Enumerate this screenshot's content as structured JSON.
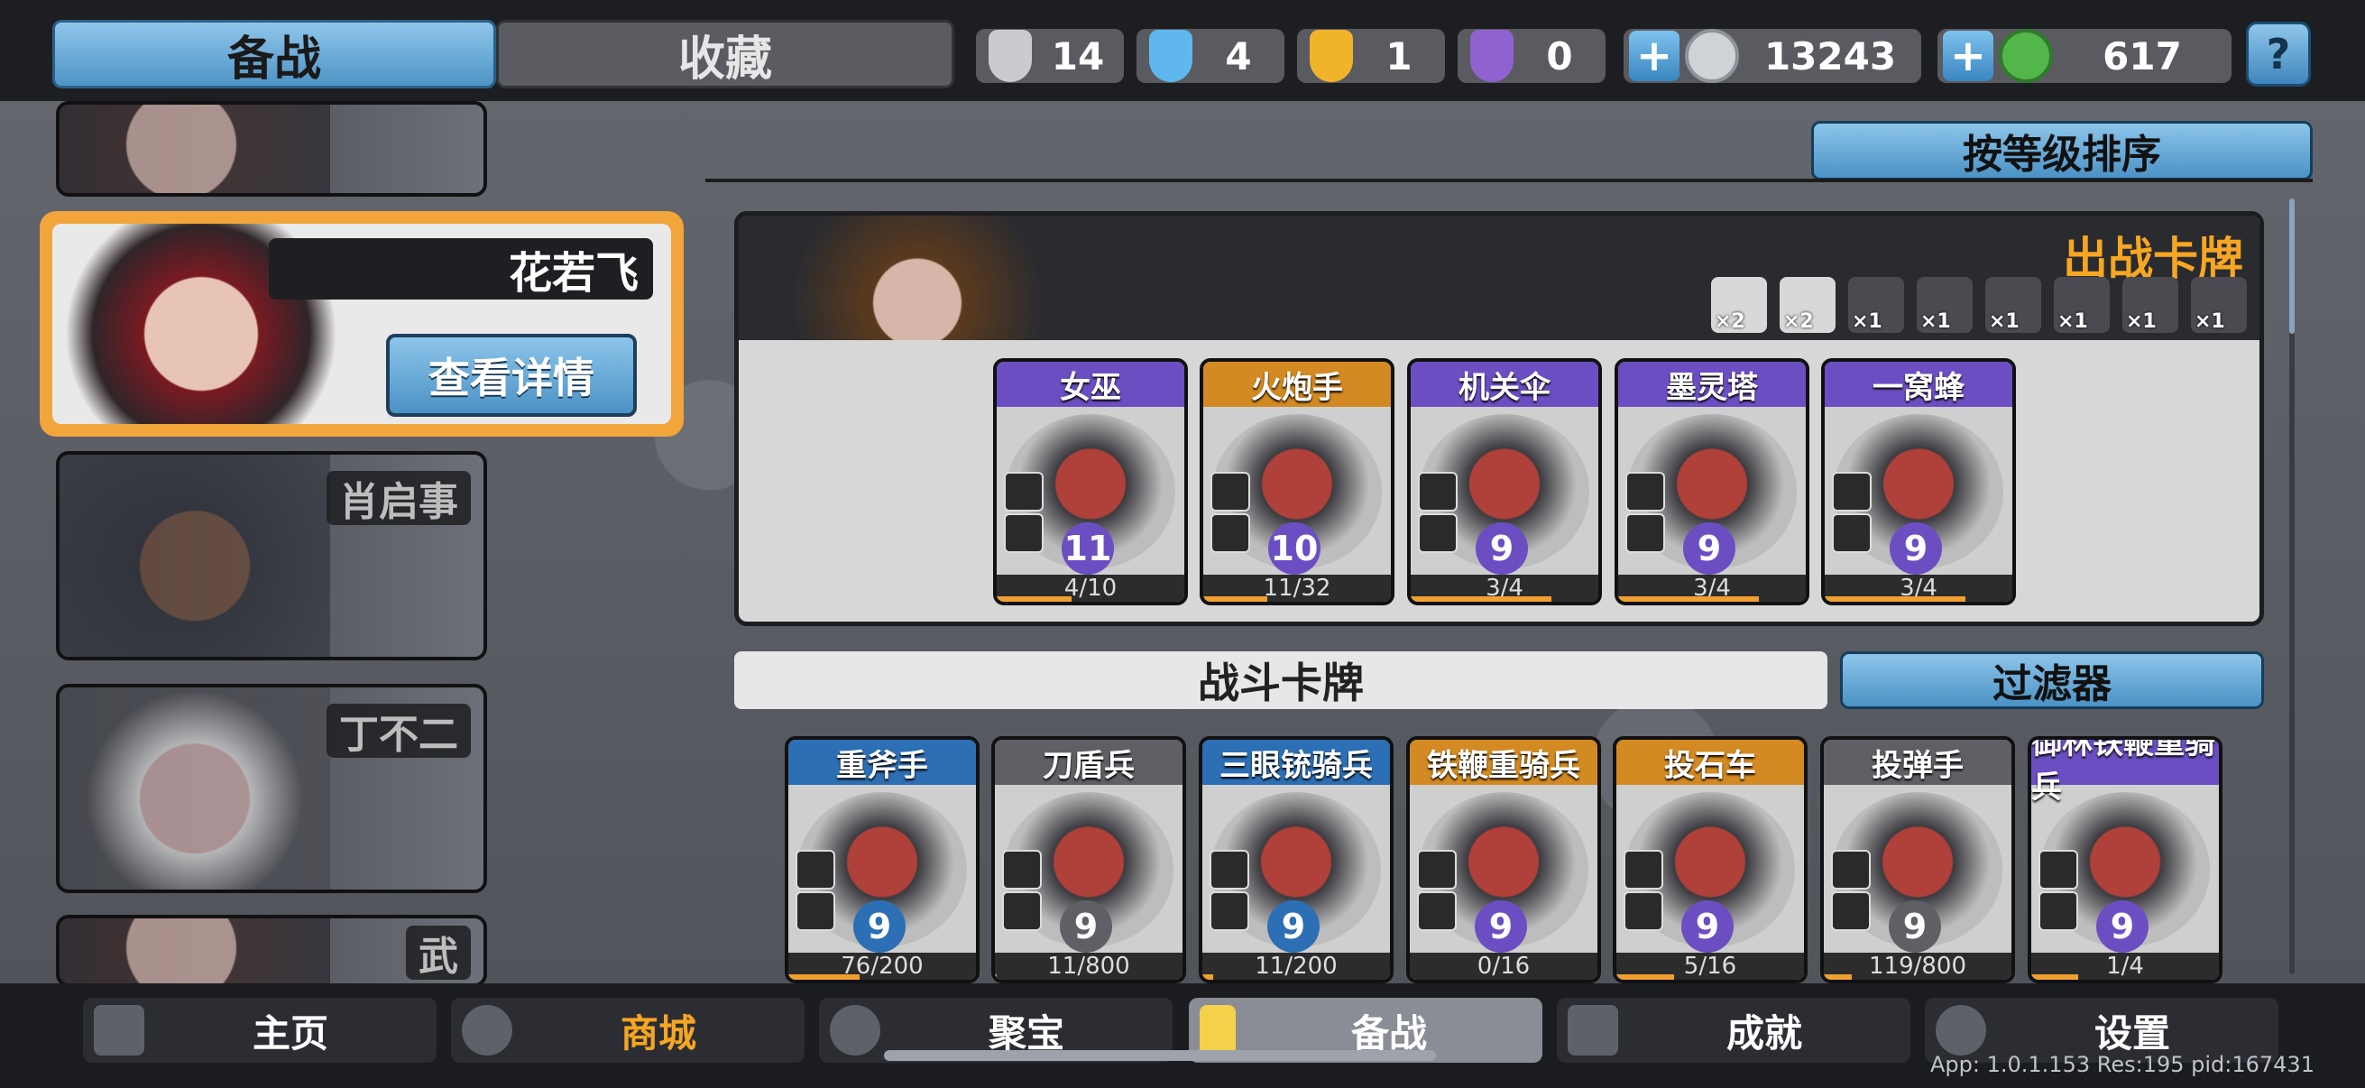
{
  "top_tabs": {
    "active": "备战",
    "inactive": "收藏"
  },
  "resources": [
    {
      "icon": "silver-shield-icon",
      "value": "14",
      "color": "#c9cbd0"
    },
    {
      "icon": "blue-shield-icon",
      "value": "4",
      "color": "#5fb7ee"
    },
    {
      "icon": "gold-shield-icon",
      "value": "1",
      "color": "#f0b42a"
    },
    {
      "icon": "purple-shield-icon",
      "value": "0",
      "color": "#8e63cf"
    }
  ],
  "currencies": [
    {
      "icon": "silver-coin-icon",
      "value": "13243",
      "color": "#cfd2d6"
    },
    {
      "icon": "green-gem-icon",
      "value": "617",
      "color": "#52b64a"
    }
  ],
  "help_label": "?",
  "heroes": [
    {
      "name": "花若飞",
      "selected": true,
      "detail_label": "查看详情"
    },
    {
      "name": "肖启事"
    },
    {
      "name": "丁不二"
    },
    {
      "name": "武"
    }
  ],
  "sort_label": "按等级排序",
  "deploy": {
    "title": "出战卡牌",
    "tags": [
      {
        "icon": "sword-tag-icon",
        "count": "×2",
        "active": true
      },
      {
        "icon": "spear-tag-icon",
        "count": "×2",
        "active": true
      },
      {
        "icon": "skull-tag-icon",
        "count": "×1",
        "active": false
      },
      {
        "icon": "helmet-tag-icon",
        "count": "×1",
        "active": false
      },
      {
        "icon": "wall-tag-icon",
        "count": "×1",
        "active": false
      },
      {
        "icon": "horse-tag-icon",
        "count": "×1",
        "active": false
      },
      {
        "icon": "gear-tag-icon",
        "count": "×1",
        "active": false
      },
      {
        "icon": "star-tag-icon",
        "count": "×1",
        "active": false
      }
    ],
    "cards": [
      {
        "name": "女巫",
        "level": "11",
        "progress": "4/10",
        "fill": 0.4,
        "rarity": "purple"
      },
      {
        "name": "火炮手",
        "level": "10",
        "progress": "11/32",
        "fill": 0.34,
        "rarity": "orange"
      },
      {
        "name": "机关伞",
        "level": "9",
        "progress": "3/4",
        "fill": 0.75,
        "rarity": "purple"
      },
      {
        "name": "墨灵塔",
        "level": "9",
        "progress": "3/4",
        "fill": 0.75,
        "rarity": "purple"
      },
      {
        "name": "一窝蜂",
        "level": "9",
        "progress": "3/4",
        "fill": 0.75,
        "rarity": "purple"
      }
    ]
  },
  "battle": {
    "title": "战斗卡牌",
    "filter_label": "过滤器",
    "cards": [
      {
        "name": "重斧手",
        "level": "9",
        "progress": "76/200",
        "fill": 0.38,
        "rarity": "blue"
      },
      {
        "name": "刀盾兵",
        "level": "9",
        "progress": "11/800",
        "fill": 0.01,
        "rarity": "gray"
      },
      {
        "name": "三眼铳骑兵",
        "level": "9",
        "progress": "11/200",
        "fill": 0.06,
        "rarity": "blue"
      },
      {
        "name": "铁鞭重骑兵",
        "level": "9",
        "progress": "0/16",
        "fill": 0.0,
        "rarity": "orange"
      },
      {
        "name": "投石车",
        "level": "9",
        "progress": "5/16",
        "fill": 0.31,
        "rarity": "orange"
      },
      {
        "name": "投弹手",
        "level": "9",
        "progress": "119/800",
        "fill": 0.15,
        "rarity": "gray"
      },
      {
        "name": "御林铁鞭重骑兵",
        "level": "9",
        "progress": "1/4",
        "fill": 0.25,
        "rarity": "purple"
      }
    ]
  },
  "nav": [
    {
      "label": "主页",
      "icon": "home-icon"
    },
    {
      "label": "商城",
      "icon": "shop-coins-icon"
    },
    {
      "label": "聚宝",
      "icon": "treasure-icon"
    },
    {
      "label": "备战",
      "icon": "cards-icon"
    },
    {
      "label": "成就",
      "icon": "achievement-icon"
    },
    {
      "label": "设置",
      "icon": "gear-icon"
    }
  ],
  "footer": "App: 1.0.1.153 Res:195 pid:167431"
}
